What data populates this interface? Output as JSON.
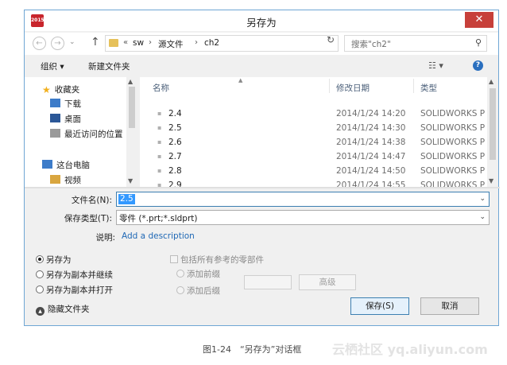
{
  "window": {
    "title": "另存为",
    "app_icon_text": "2015",
    "close_symbol": "✕"
  },
  "nav": {
    "back_symbol": "←",
    "forward_symbol": "→",
    "history_symbol": "⌄",
    "up_symbol": "↑",
    "breadcrumb": {
      "overflow": "«",
      "items": [
        "sw",
        "源文件",
        "ch2"
      ],
      "separator": "›"
    },
    "dropdown_symbol": "⌄",
    "refresh_symbol": "↻",
    "search_placeholder": "搜索\"ch2\"",
    "search_symbol": "⚲"
  },
  "toolbar": {
    "organize": "组织 ▾",
    "new_folder": "新建文件夹",
    "view_symbol": "☷ ▾",
    "help_symbol": "?"
  },
  "sidebar": {
    "items": [
      {
        "label": "收藏夹",
        "icon": "star-icon",
        "color": "#f2b01e"
      },
      {
        "label": "下载",
        "icon": "download-folder-icon",
        "color": "#3d7cc9"
      },
      {
        "label": "桌面",
        "icon": "desktop-icon",
        "color": "#2b5797"
      },
      {
        "label": "最近访问的位置",
        "icon": "recent-places-icon",
        "color": "#8a8a8a"
      },
      {
        "label": "这台电脑",
        "icon": "computer-icon",
        "color": "#3d7cc9"
      },
      {
        "label": "视频",
        "icon": "video-folder-icon",
        "color": "#d9a63f"
      }
    ]
  },
  "file_list": {
    "columns": [
      "名称",
      "修改日期",
      "类型"
    ],
    "rows": [
      {
        "name": "2.4",
        "date": "2014/1/24 14:20",
        "type": "SOLIDWORKS P"
      },
      {
        "name": "2.5",
        "date": "2014/1/24 14:30",
        "type": "SOLIDWORKS P"
      },
      {
        "name": "2.6",
        "date": "2014/1/24 14:38",
        "type": "SOLIDWORKS P"
      },
      {
        "name": "2.7",
        "date": "2014/1/24 14:47",
        "type": "SOLIDWORKS P"
      },
      {
        "name": "2.8",
        "date": "2014/1/24 14:50",
        "type": "SOLIDWORKS P"
      },
      {
        "name": "2.9",
        "date": "2014/1/24 14:55",
        "type": "SOLIDWORKS P"
      }
    ]
  },
  "form": {
    "filename_label": "文件名(N):",
    "filename_value": "2.5",
    "type_label": "保存类型(T):",
    "type_value": "零件 (*.prt;*.sldprt)",
    "desc_label": "说明:",
    "desc_link": "Add a description"
  },
  "options": {
    "save_as": "另存为",
    "save_copy_continue": "另存为副本并继续",
    "save_copy_open": "另存为副本并打开",
    "include_refs": "包括所有参考的零部件",
    "add_prefix": "添加前缀",
    "add_suffix": "添加后缀",
    "advanced": "高级",
    "hide_folders": "隐藏文件夹"
  },
  "buttons": {
    "save": "保存(S)",
    "cancel": "取消"
  },
  "caption": "图1-24　“另存为”对话框",
  "watermark": "云栖社区 yq.aliyun.com"
}
